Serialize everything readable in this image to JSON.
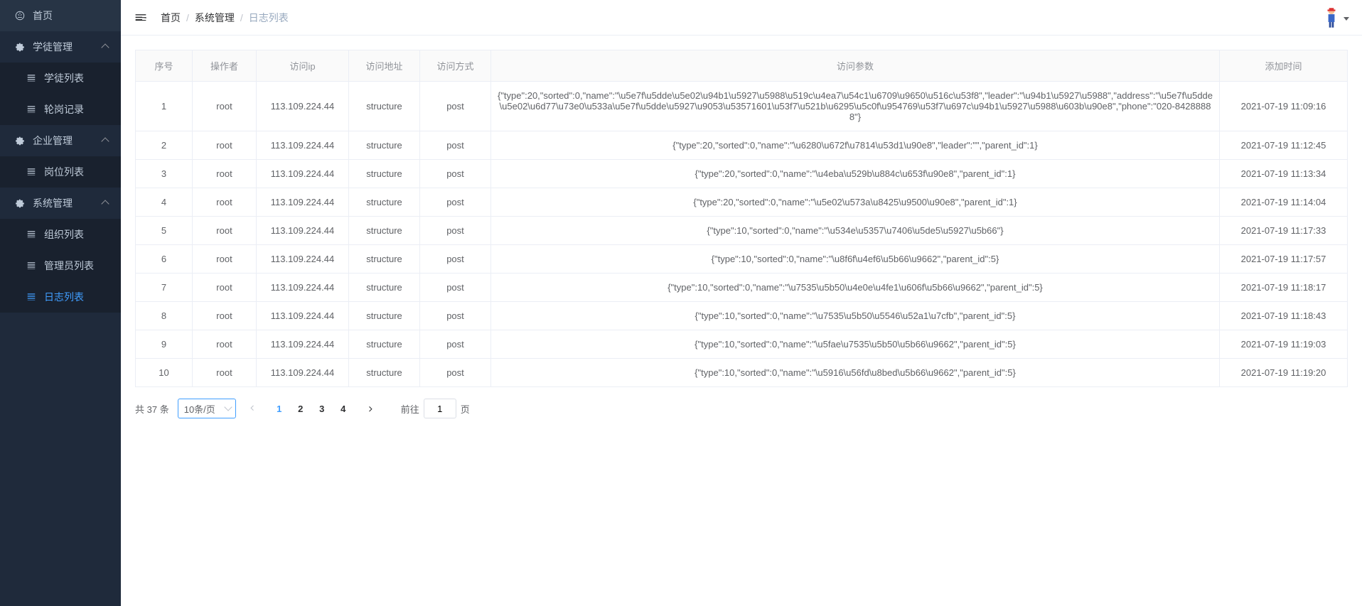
{
  "sidebar": {
    "home": "首页",
    "apprentice_mgmt": "学徒管理",
    "apprentice_list": "学徒列表",
    "rotation_record": "轮岗记录",
    "enterprise_mgmt": "企业管理",
    "position_list": "岗位列表",
    "system_mgmt": "系统管理",
    "org_list": "组织列表",
    "admin_list": "管理员列表",
    "log_list": "日志列表"
  },
  "breadcrumb": {
    "home": "首页",
    "system": "系统管理",
    "logs": "日志列表"
  },
  "table": {
    "headers": {
      "seq": "序号",
      "operator": "操作者",
      "ip": "访问ip",
      "url": "访问地址",
      "method": "访问方式",
      "params": "访问参数",
      "time": "添加时间"
    },
    "rows": [
      {
        "seq": "1",
        "operator": "root",
        "ip": "113.109.224.44",
        "url": "structure",
        "method": "post",
        "params": "{\"type\":20,\"sorted\":0,\"name\":\"\\u5e7f\\u5dde\\u5e02\\u94b1\\u5927\\u5988\\u519c\\u4ea7\\u54c1\\u6709\\u9650\\u516c\\u53f8\",\"leader\":\"\\u94b1\\u5927\\u5988\",\"address\":\"\\u5e7f\\u5dde\\u5e02\\u6d77\\u73e0\\u533a\\u5e7f\\u5dde\\u5927\\u9053\\u53571601\\u53f7\\u521b\\u6295\\u5c0f\\u954769\\u53f7\\u697c\\u94b1\\u5927\\u5988\\u603b\\u90e8\",\"phone\":\"020-84288888\"}",
        "time": "2021-07-19 11:09:16"
      },
      {
        "seq": "2",
        "operator": "root",
        "ip": "113.109.224.44",
        "url": "structure",
        "method": "post",
        "params": "{\"type\":20,\"sorted\":0,\"name\":\"\\u6280\\u672f\\u7814\\u53d1\\u90e8\",\"leader\":\"\",\"parent_id\":1}",
        "time": "2021-07-19 11:12:45"
      },
      {
        "seq": "3",
        "operator": "root",
        "ip": "113.109.224.44",
        "url": "structure",
        "method": "post",
        "params": "{\"type\":20,\"sorted\":0,\"name\":\"\\u4eba\\u529b\\u884c\\u653f\\u90e8\",\"parent_id\":1}",
        "time": "2021-07-19 11:13:34"
      },
      {
        "seq": "4",
        "operator": "root",
        "ip": "113.109.224.44",
        "url": "structure",
        "method": "post",
        "params": "{\"type\":20,\"sorted\":0,\"name\":\"\\u5e02\\u573a\\u8425\\u9500\\u90e8\",\"parent_id\":1}",
        "time": "2021-07-19 11:14:04"
      },
      {
        "seq": "5",
        "operator": "root",
        "ip": "113.109.224.44",
        "url": "structure",
        "method": "post",
        "params": "{\"type\":10,\"sorted\":0,\"name\":\"\\u534e\\u5357\\u7406\\u5de5\\u5927\\u5b66\"}",
        "time": "2021-07-19 11:17:33"
      },
      {
        "seq": "6",
        "operator": "root",
        "ip": "113.109.224.44",
        "url": "structure",
        "method": "post",
        "params": "{\"type\":10,\"sorted\":0,\"name\":\"\\u8f6f\\u4ef6\\u5b66\\u9662\",\"parent_id\":5}",
        "time": "2021-07-19 11:17:57"
      },
      {
        "seq": "7",
        "operator": "root",
        "ip": "113.109.224.44",
        "url": "structure",
        "method": "post",
        "params": "{\"type\":10,\"sorted\":0,\"name\":\"\\u7535\\u5b50\\u4e0e\\u4fe1\\u606f\\u5b66\\u9662\",\"parent_id\":5}",
        "time": "2021-07-19 11:18:17"
      },
      {
        "seq": "8",
        "operator": "root",
        "ip": "113.109.224.44",
        "url": "structure",
        "method": "post",
        "params": "{\"type\":10,\"sorted\":0,\"name\":\"\\u7535\\u5b50\\u5546\\u52a1\\u7cfb\",\"parent_id\":5}",
        "time": "2021-07-19 11:18:43"
      },
      {
        "seq": "9",
        "operator": "root",
        "ip": "113.109.224.44",
        "url": "structure",
        "method": "post",
        "params": "{\"type\":10,\"sorted\":0,\"name\":\"\\u5fae\\u7535\\u5b50\\u5b66\\u9662\",\"parent_id\":5}",
        "time": "2021-07-19 11:19:03"
      },
      {
        "seq": "10",
        "operator": "root",
        "ip": "113.109.224.44",
        "url": "structure",
        "method": "post",
        "params": "{\"type\":10,\"sorted\":0,\"name\":\"\\u5916\\u56fd\\u8bed\\u5b66\\u9662\",\"parent_id\":5}",
        "time": "2021-07-19 11:19:20"
      }
    ]
  },
  "pager": {
    "total_prefix": "共 ",
    "total_count": "37",
    "total_suffix": " 条",
    "size_label": "10条/页",
    "pages": [
      "1",
      "2",
      "3",
      "4"
    ],
    "current": "1",
    "jump_prefix": "前往",
    "jump_value": "1",
    "jump_suffix": "页"
  }
}
